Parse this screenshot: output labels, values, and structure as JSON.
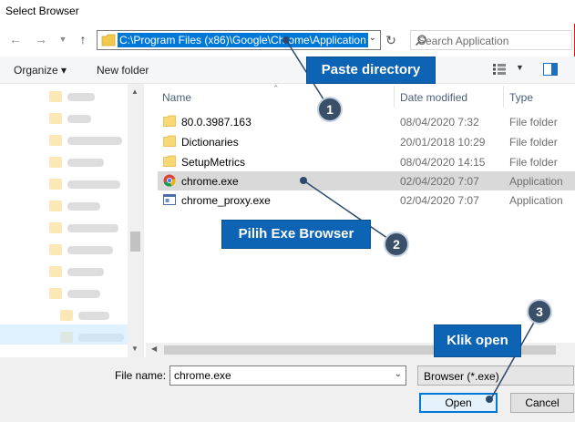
{
  "window": {
    "title": "Select Browser"
  },
  "address": {
    "path": "C:\\Program Files (x86)\\Google\\Chrome\\Application"
  },
  "search": {
    "placeholder": "Search Application"
  },
  "toolbar": {
    "organize": "Organize",
    "new_folder": "New folder"
  },
  "columns": {
    "name": "Name",
    "date": "Date modified",
    "type": "Type"
  },
  "files": [
    {
      "name": "80.0.3987.163",
      "date": "08/04/2020 7:32",
      "type": "File folder",
      "icon": "folder-icon"
    },
    {
      "name": "Dictionaries",
      "date": "20/01/2018 10:29",
      "type": "File folder",
      "icon": "folder-icon"
    },
    {
      "name": "SetupMetrics",
      "date": "08/04/2020 14:15",
      "type": "File folder",
      "icon": "folder-icon"
    },
    {
      "name": "chrome.exe",
      "date": "02/04/2020 7:07",
      "type": "Application",
      "icon": "chrome-icon"
    },
    {
      "name": "chrome_proxy.exe",
      "date": "02/04/2020 7:07",
      "type": "Application",
      "icon": "exe-icon"
    }
  ],
  "footer": {
    "file_name_label": "File name:",
    "file_name_value": "chrome.exe",
    "filter": "Browser (*.exe)",
    "open": "Open",
    "cancel": "Cancel"
  },
  "annotations": [
    {
      "label": "Paste directory",
      "number": "1"
    },
    {
      "label": "Pilih Exe Browser",
      "number": "2"
    },
    {
      "label": "Klik open",
      "number": "3"
    }
  ],
  "colors": {
    "accent": "#0078d7",
    "callout": "#0e64b4",
    "badge": "#3a4f68",
    "selection": "#d9d9d9"
  }
}
